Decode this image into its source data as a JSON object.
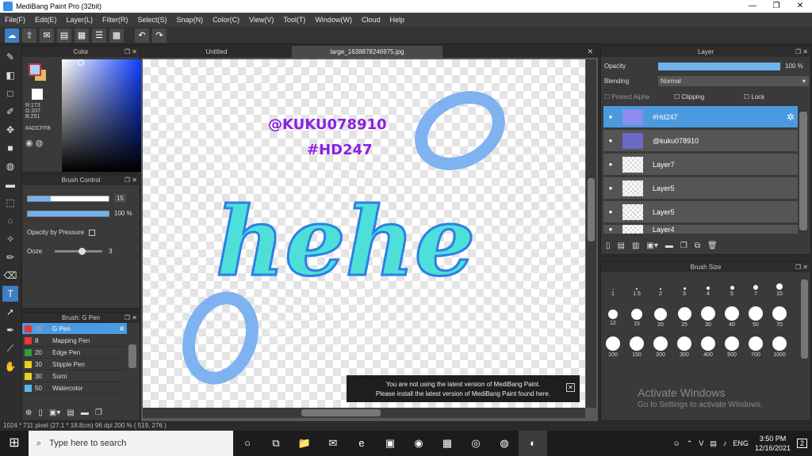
{
  "window": {
    "title": "MediBang Paint Pro (32bit)"
  },
  "menu": [
    "File(F)",
    "Edit(E)",
    "Layer(L)",
    "Filter(R)",
    "Select(S)",
    "Snap(N)",
    "Color(C)",
    "View(V)",
    "Tool(T)",
    "Window(W)",
    "Cloud",
    "Help"
  ],
  "color_panel": {
    "title": "Color",
    "r": "R:173",
    "g": "G:207",
    "b": "B:251",
    "hex": "#ADCFFB",
    "current_color": "#adcffb"
  },
  "brush_control": {
    "title": "Brush Control",
    "size_value": "15",
    "opacity_value": "100 %",
    "opacity_by_pressure_label": "Opacity by Pressure",
    "ooze_label": "Ooze",
    "ooze_value": "3"
  },
  "brush_list": {
    "title": "Brush: G Pen",
    "items": [
      {
        "size": "15",
        "name": "G Pen",
        "color": "#e53935"
      },
      {
        "size": "8",
        "name": "Mapping Pen",
        "color": "#e53935"
      },
      {
        "size": "20",
        "name": "Edge Pen",
        "color": "#2e9e3a"
      },
      {
        "size": "30",
        "name": "Stipple Pen",
        "color": "#e3d21e"
      },
      {
        "size": "30",
        "name": "Sumi",
        "color": "#e3d21e"
      },
      {
        "size": "50",
        "name": "Watercolor",
        "color": "#5ab8ef"
      }
    ]
  },
  "tabs": [
    "Untitled",
    "large_1638878246975.jpg"
  ],
  "canvas_art": {
    "text1": "@KUKU078910",
    "text2": "#HD247",
    "text3": "hehe"
  },
  "toast": {
    "line1": "You are not using the latest version of MediBang Paint.",
    "line2": "Please install the latest version of MediBang Paint found here.",
    "close": "✕"
  },
  "layer_panel": {
    "title": "Layer",
    "opacity_label": "Opacity",
    "opacity_value": "100 %",
    "blending_label": "Blending",
    "blending_value": "Normal",
    "protect_alpha_label": "Protect Alpha",
    "clipping_label": "Clipping",
    "lock_label": "Lock",
    "layers": [
      "#Hd247",
      "@kuku078910",
      "Layer7",
      "Layer5",
      "Layer5",
      "Layer4"
    ]
  },
  "brush_size": {
    "title": "Brush Size",
    "sizes": [
      "1",
      "1.5",
      "2",
      "3",
      "4",
      "5",
      "7",
      "10",
      "12",
      "15",
      "20",
      "25",
      "30",
      "40",
      "50",
      "70",
      "100",
      "150",
      "200",
      "300",
      "400",
      "500",
      "700",
      "1000"
    ]
  },
  "watermark": {
    "line1": "Activate Windows",
    "line2": "Go to Settings to activate Windows."
  },
  "status": "1024 * 711 pixel   (27.1 * 18.8cm)   96 dpi   200 %   ( 519, 276 )",
  "taskbar": {
    "search_placeholder": "Type here to search",
    "lang": "ENG",
    "time": "3:50 PM",
    "date": "12/16/2021",
    "notifications": "2"
  }
}
